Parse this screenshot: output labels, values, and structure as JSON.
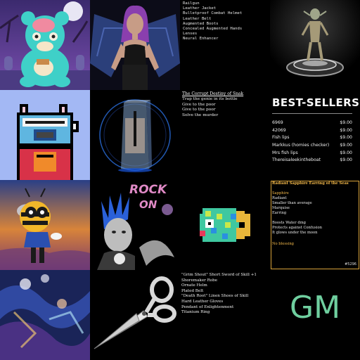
{
  "tiles": {
    "loot_mono": {
      "items": [
        "Railgun",
        "Leather Jacket",
        "Bulletproof Combat Helmet",
        "Leather Belt",
        "Augmented Boots",
        "Concealed Augmented Hands",
        "Lenses",
        "Neural Enhancer"
      ]
    },
    "snak": {
      "title": "The Corrupt Destiny of Snak",
      "items": [
        "Trap the genie in its bottle",
        "Give to the poor",
        "Give to the poor",
        "Solve the murder"
      ]
    },
    "best_sellers": {
      "title": "BEST-SELLERS",
      "rows": [
        {
          "name": "6969",
          "price": "$9.00"
        },
        {
          "name": "42069",
          "price": "$9.00"
        },
        {
          "name": "Fish lips",
          "price": "$9.00"
        },
        {
          "name": "Markkus (homies checker)",
          "price": "$9.00"
        },
        {
          "name": "Mrs fish lips",
          "price": "$9.00"
        },
        {
          "name": "Thereisaleekintheboat",
          "price": "$9.00"
        }
      ]
    },
    "gem": {
      "title": "Radiant Sapphire Earring of the Seas",
      "category": "Sapphire",
      "attributes": [
        "Radiant",
        "Smaller than average",
        "Marquise",
        "Earring"
      ],
      "effects": [
        "Boosts Water dmg",
        "Protects against Confusion",
        "It glows under the moon"
      ],
      "blessing": "No blessing",
      "id": "#5296"
    },
    "sword": {
      "items": [
        "\"Grim Shout\" Short Sword of Skill +1",
        "Shoremaker Robe",
        "Ornate Helm",
        "Plated Belt",
        "\"Death Root\" Linen Shoes of Skill",
        "Hard Leather Gloves",
        "Pendant of Enlightenment",
        "Titanium Ring"
      ]
    },
    "gm": {
      "text": "GM"
    },
    "rock": {
      "line1": "ROCK",
      "line2": "ON"
    }
  },
  "colors": {
    "gem_border": "#d9a33a",
    "gem_gold": "#f2b84a",
    "gm_green": "#6fcf9f",
    "pixel_bg": "#a3b8f4"
  }
}
